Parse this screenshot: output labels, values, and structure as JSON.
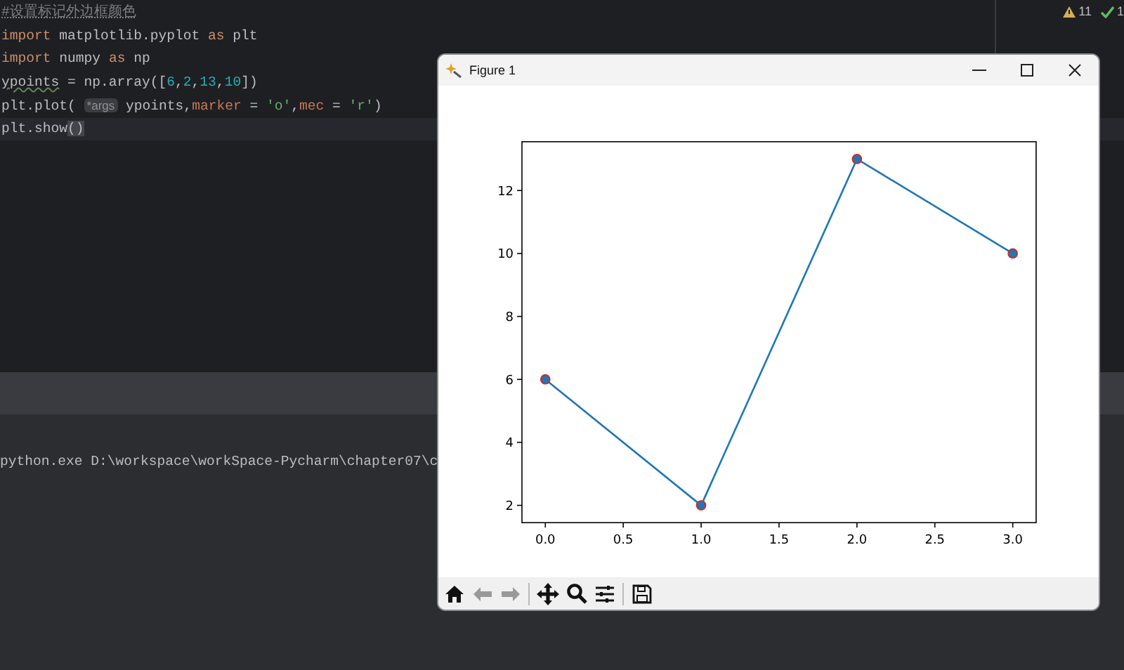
{
  "editor": {
    "lines": [
      {
        "current": false,
        "tokens": [
          {
            "kind": "comment",
            "text": "#设置标记外边框颜色"
          }
        ]
      },
      {
        "current": false,
        "tokens": [
          {
            "kind": "keyword",
            "text": "import"
          },
          {
            "kind": "plain",
            "text": " matplotlib.pyplot "
          },
          {
            "kind": "keyword",
            "text": "as"
          },
          {
            "kind": "plain",
            "text": " plt"
          }
        ]
      },
      {
        "current": false,
        "tokens": [
          {
            "kind": "keyword",
            "text": "import"
          },
          {
            "kind": "plain",
            "text": " numpy "
          },
          {
            "kind": "keyword",
            "text": "as"
          },
          {
            "kind": "plain",
            "text": " np"
          }
        ]
      },
      {
        "current": false,
        "tokens": [
          {
            "kind": "warn",
            "text": "ypoints"
          },
          {
            "kind": "plain",
            "text": " = np.array(["
          },
          {
            "kind": "number",
            "text": "6"
          },
          {
            "kind": "plain",
            "text": ","
          },
          {
            "kind": "number",
            "text": "2"
          },
          {
            "kind": "plain",
            "text": ","
          },
          {
            "kind": "number",
            "text": "13"
          },
          {
            "kind": "plain",
            "text": ","
          },
          {
            "kind": "number",
            "text": "10"
          },
          {
            "kind": "plain",
            "text": "])"
          }
        ]
      },
      {
        "current": false,
        "tokens": [
          {
            "kind": "plain",
            "text": "plt.plot( "
          },
          {
            "kind": "hint",
            "text": "*args"
          },
          {
            "kind": "plain",
            "text": " ypoints,"
          },
          {
            "kind": "param",
            "text": "marker"
          },
          {
            "kind": "plain",
            "text": " = "
          },
          {
            "kind": "string",
            "text": "'o'"
          },
          {
            "kind": "plain",
            "text": ","
          },
          {
            "kind": "param",
            "text": "mec"
          },
          {
            "kind": "plain",
            "text": " = "
          },
          {
            "kind": "string",
            "text": "'r'"
          },
          {
            "kind": "plain",
            "text": ")"
          }
        ]
      },
      {
        "current": true,
        "tokens": [
          {
            "kind": "plain",
            "text": "plt.show"
          },
          {
            "kind": "brace",
            "text": "()"
          }
        ]
      }
    ]
  },
  "inspections": {
    "warnings": "11",
    "ok": "1"
  },
  "terminal": {
    "line": "python.exe D:\\workspace\\workSpace-Pycharm\\chapter07\\c"
  },
  "figure_window": {
    "title": "Figure 1",
    "chart_data": {
      "type": "line",
      "x": [
        0,
        1,
        2,
        3
      ],
      "series": [
        {
          "color": "#1f77b4",
          "marker": "o",
          "values": [
            6,
            2,
            13,
            10
          ]
        }
      ],
      "xlim": [
        -0.15,
        3.15
      ],
      "ylim": [
        1.45,
        13.55
      ],
      "xticks": [
        {
          "value": 0,
          "label": "0.0"
        },
        {
          "value": 0.5,
          "label": "0.5"
        },
        {
          "value": 1,
          "label": "1.0"
        },
        {
          "value": 1.5,
          "label": "1.5"
        },
        {
          "value": 2,
          "label": "2.0"
        },
        {
          "value": 2.5,
          "label": "2.5"
        },
        {
          "value": 3,
          "label": "3.0"
        }
      ],
      "yticks": [
        2,
        4,
        6,
        8,
        10,
        12
      ]
    }
  }
}
